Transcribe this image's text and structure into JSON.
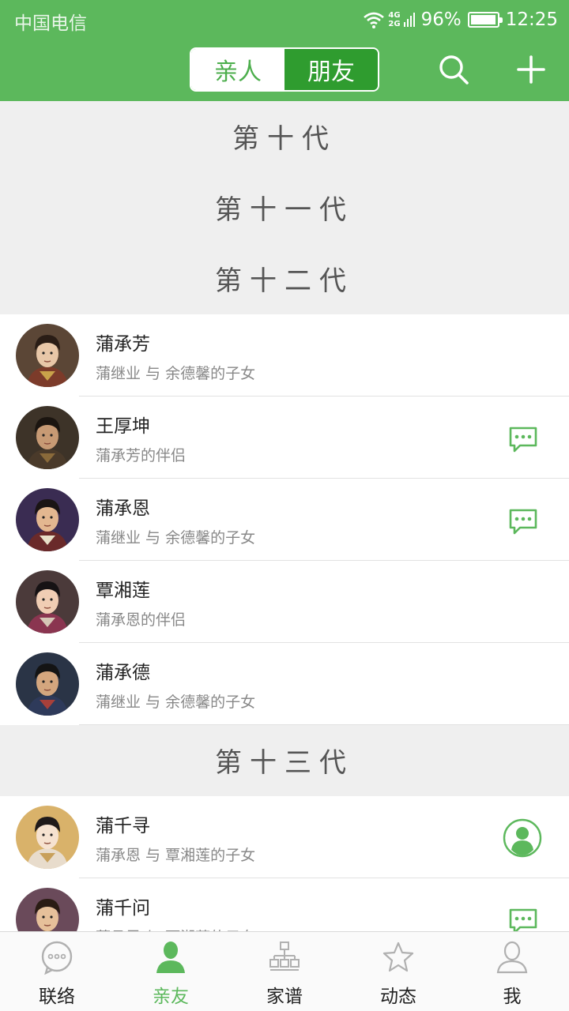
{
  "status_bar": {
    "carrier": "中国电信",
    "network": "4G\n2G",
    "battery": "96%",
    "battery_level": 0.96,
    "time": "12:25"
  },
  "header": {
    "tabs": [
      {
        "label": "亲人",
        "active": false
      },
      {
        "label": "朋友",
        "active": true
      }
    ],
    "search_icon": "search-icon",
    "add_icon": "plus-icon"
  },
  "colors": {
    "primary": "#5cb85c",
    "primary_dark": "#2f9c2f",
    "section_bg": "#efefef"
  },
  "generations": [
    {
      "title": "第十代",
      "members": []
    },
    {
      "title": "第十一代",
      "members": []
    },
    {
      "title": "第十二代",
      "members": [
        {
          "name": "蒲承芳",
          "relation": "蒲继业 与 余德馨的子女",
          "action": "none"
        },
        {
          "name": "王厚坤",
          "relation": "蒲承芳的伴侣",
          "action": "chat"
        },
        {
          "name": "蒲承恩",
          "relation": "蒲继业 与 余德馨的子女",
          "action": "chat"
        },
        {
          "name": "覃湘莲",
          "relation": "蒲承恩的伴侣",
          "action": "none"
        },
        {
          "name": "蒲承德",
          "relation": "蒲继业 与 余德馨的子女",
          "action": "none"
        }
      ]
    },
    {
      "title": "第十三代",
      "members": [
        {
          "name": "蒲千寻",
          "relation": "蒲承恩 与 覃湘莲的子女",
          "action": "profile"
        },
        {
          "name": "蒲千问",
          "relation": "蒲承恩 与 覃湘莲的子女",
          "action": "chat"
        }
      ]
    }
  ],
  "tabbar": [
    {
      "label": "联络",
      "icon": "chat-bubble-icon",
      "active": false
    },
    {
      "label": "亲友",
      "icon": "person-icon",
      "active": true
    },
    {
      "label": "家谱",
      "icon": "family-tree-icon",
      "active": false
    },
    {
      "label": "动态",
      "icon": "star-icon",
      "active": false
    },
    {
      "label": "我",
      "icon": "user-icon",
      "active": false
    }
  ]
}
